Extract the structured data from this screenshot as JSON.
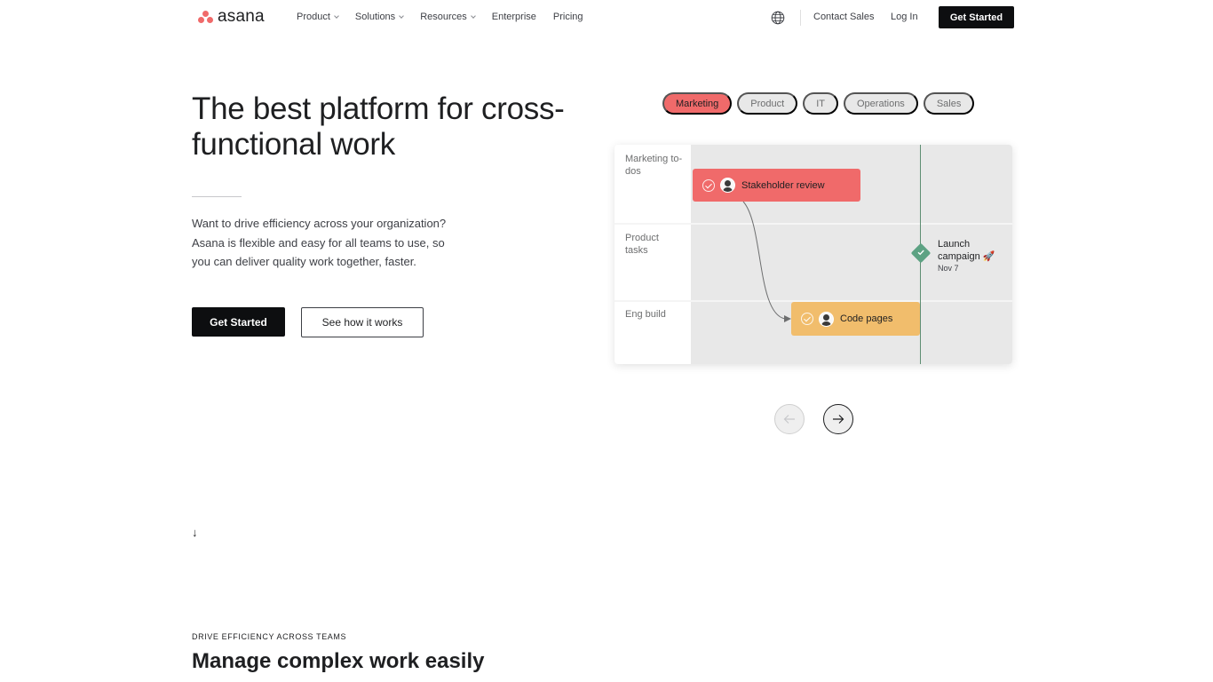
{
  "nav": {
    "logo_text": "asana",
    "links": [
      {
        "label": "Product",
        "dropdown": true
      },
      {
        "label": "Solutions",
        "dropdown": true
      },
      {
        "label": "Resources",
        "dropdown": true
      },
      {
        "label": "Enterprise",
        "dropdown": false
      },
      {
        "label": "Pricing",
        "dropdown": false
      }
    ],
    "globe_icon": "globe-icon",
    "contact_sales": "Contact Sales",
    "log_in": "Log In",
    "cta": "Get Started"
  },
  "hero": {
    "title": "The best platform for cross-functional work",
    "description": "Want to drive efficiency across your organization? Asana is flexible and easy for all teams to use, so you can deliver quality work together, faster.",
    "primary_button": "Get Started",
    "secondary_button": "See how it works"
  },
  "demo": {
    "tabs": [
      {
        "label": "Marketing",
        "active": true
      },
      {
        "label": "Product",
        "active": false
      },
      {
        "label": "IT",
        "active": false
      },
      {
        "label": "Operations",
        "active": false
      },
      {
        "label": "Sales",
        "active": false
      }
    ],
    "rows": [
      {
        "label": "Marketing to-dos"
      },
      {
        "label": "Product tasks"
      },
      {
        "label": "Eng build"
      }
    ],
    "tasks": [
      {
        "label": "Stakeholder review",
        "color": "#f06a6a"
      },
      {
        "label": "Code pages",
        "color": "#f1bd6c"
      }
    ],
    "milestone": {
      "title": "Launch campaign 🚀",
      "date": "Nov 7",
      "color": "#5da283"
    }
  },
  "carousel": {
    "prev_icon": "arrow-left-icon",
    "next_icon": "arrow-right-icon"
  },
  "scroll_indicator": "↓",
  "section": {
    "eyebrow": "DRIVE EFFICIENCY ACROSS TEAMS",
    "title": "Manage complex work easily"
  },
  "colors": {
    "brand": "#f06a6a",
    "dark": "#0d0e10",
    "milestone": "#5da283",
    "task_yellow": "#f1bd6c"
  }
}
